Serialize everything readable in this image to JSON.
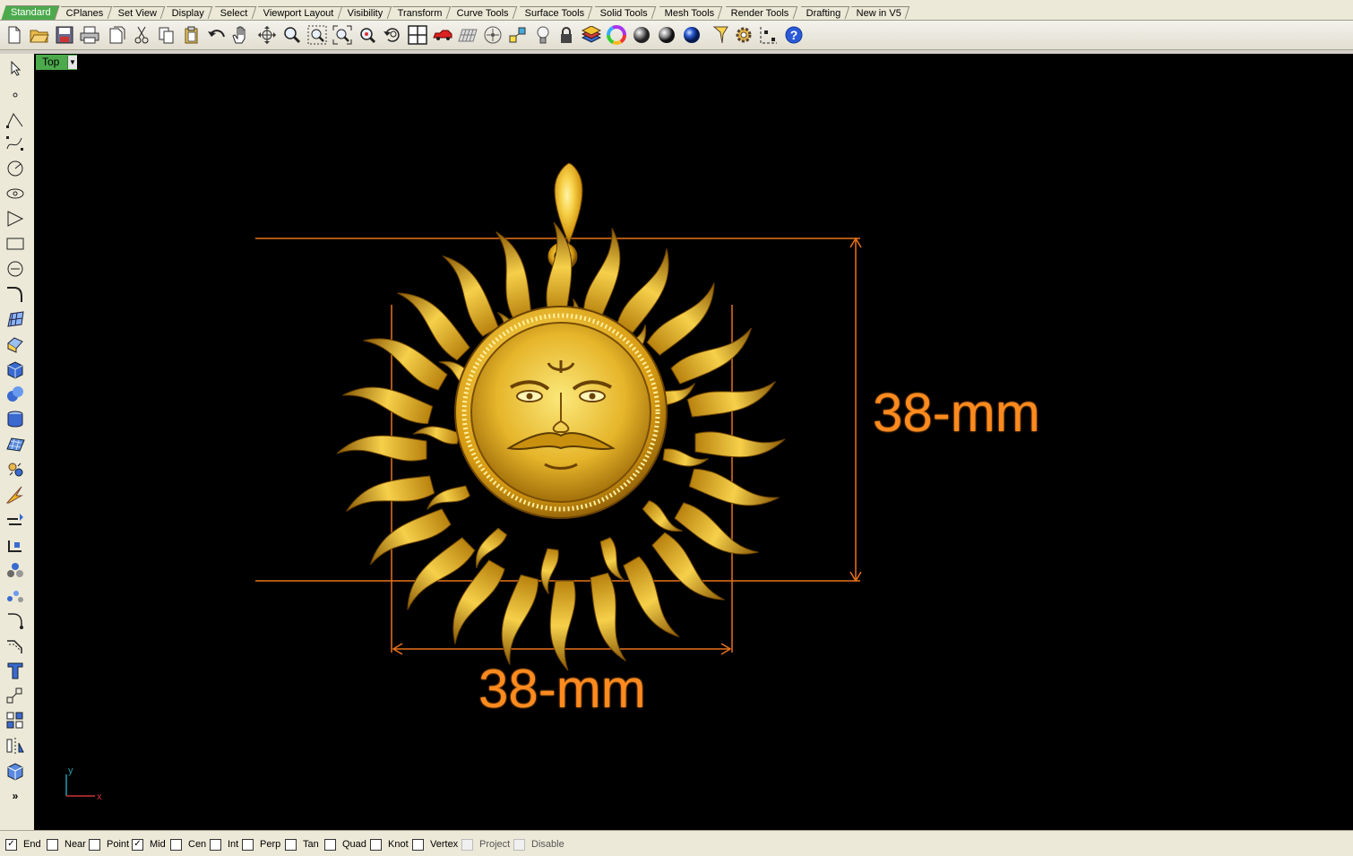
{
  "tabs": [
    "Standard",
    "CPlanes",
    "Set View",
    "Display",
    "Select",
    "Viewport Layout",
    "Visibility",
    "Transform",
    "Curve Tools",
    "Surface Tools",
    "Solid Tools",
    "Mesh Tools",
    "Render Tools",
    "Drafting",
    "New in V5"
  ],
  "active_tab": "Standard",
  "toolbar_icons": [
    "new-file-icon",
    "open-folder-icon",
    "save-icon",
    "print-icon",
    "import-icon",
    "cut-icon",
    "copy-icon",
    "paste-icon",
    "undo-icon",
    "pan-hand-icon",
    "rotate-view-icon",
    "zoom-icon",
    "zoom-window-icon",
    "zoom-extents-icon",
    "zoom-selected-icon",
    "undo-view-icon",
    "four-viewports-icon",
    "car-render-icon",
    "grid-plane-icon",
    "cplane-icon",
    "osnap-icon",
    "light-bulb-icon",
    "lock-icon",
    "layer-icon",
    "color-wheel-icon",
    "shaded-sphere-icon",
    "rendered-sphere-icon",
    "render-sphere-blue-icon",
    "filter-icon",
    "gear-settings-icon",
    "dimension-icon",
    "help-icon"
  ],
  "left_tools": [
    "select-arrow-icon",
    "point-icon",
    "polyline-icon",
    "curve-icon",
    "circle-icon",
    "ellipse-icon",
    "polygon-icon",
    "rectangle-icon",
    "arc-icon",
    "offset-curve-icon",
    "surface-icon",
    "extrude-icon",
    "box-solid-icon",
    "boolean-icon",
    "cylinder-icon",
    "mesh-surface-icon",
    "explode-icon",
    "flash-icon",
    "trim-icon",
    "join-icon",
    "array-icon",
    "scatter-icon",
    "fillet-icon",
    "chamfer-icon",
    "text-icon",
    "scale-icon",
    "group-icon",
    "mirror-icon",
    "cube-view-icon",
    "more-icon"
  ],
  "viewport": {
    "name": "Top",
    "height_label": "38-mm",
    "width_label": "38-mm",
    "axis_y": "y",
    "axis_x": "x",
    "dim_color": "#ff8a1e",
    "gold_color": "#e2a817"
  },
  "osnaps": [
    {
      "label": "End",
      "checked": true
    },
    {
      "label": "Near",
      "checked": false
    },
    {
      "label": "Point",
      "checked": false
    },
    {
      "label": "Mid",
      "checked": true
    },
    {
      "label": "Cen",
      "checked": false
    },
    {
      "label": "Int",
      "checked": false
    },
    {
      "label": "Perp",
      "checked": false
    },
    {
      "label": "Tan",
      "checked": false
    },
    {
      "label": "Quad",
      "checked": false
    },
    {
      "label": "Knot",
      "checked": false
    },
    {
      "label": "Vertex",
      "checked": false
    },
    {
      "label": "Project",
      "checked": false,
      "disabled": true
    },
    {
      "label": "Disable",
      "checked": false,
      "disabled": true
    }
  ]
}
